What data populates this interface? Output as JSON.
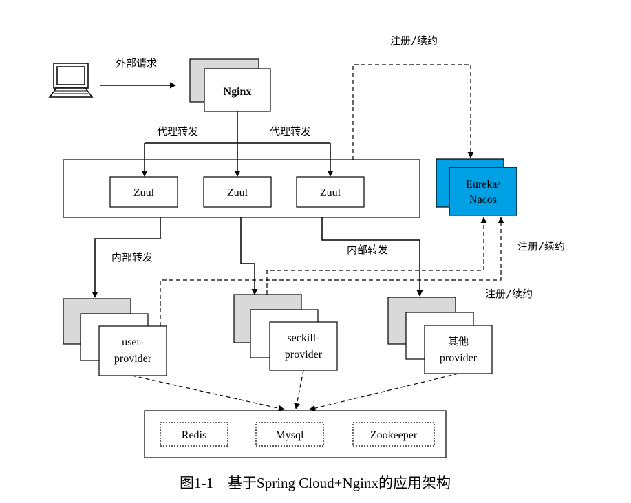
{
  "nodes": {
    "nginx": "Nginx",
    "zuul_1": "Zuul",
    "zuul_2": "Zuul",
    "zuul_3": "Zuul",
    "registry_line1": "Eureka/",
    "registry_line2": "Nacos",
    "user_provider_line1": "user-",
    "user_provider_line2": "provider",
    "seckill_provider_line1": "seckill-",
    "seckill_provider_line2": "provider",
    "other_provider_line1": "其他",
    "other_provider_line2": "provider",
    "redis": "Redis",
    "mysql": "Mysql",
    "zookeeper": "Zookeeper"
  },
  "labels": {
    "external_request": "外部请求",
    "proxy_forward_left": "代理转发",
    "proxy_forward_right": "代理转发",
    "internal_forward_left": "内部转发",
    "internal_forward_right": "内部转发",
    "register_renew_top": "注册/续约",
    "register_renew_right": "注册/续约",
    "register_renew_bottom": "注册/续约"
  },
  "caption": "图1-1　基于Spring Cloud+Nginx的应用架构",
  "colors": {
    "registry_fill": "#00a0e4",
    "shadow_fill": "#d9d9d9",
    "line": "#000000"
  },
  "icons": {
    "client": "computer-icon"
  }
}
